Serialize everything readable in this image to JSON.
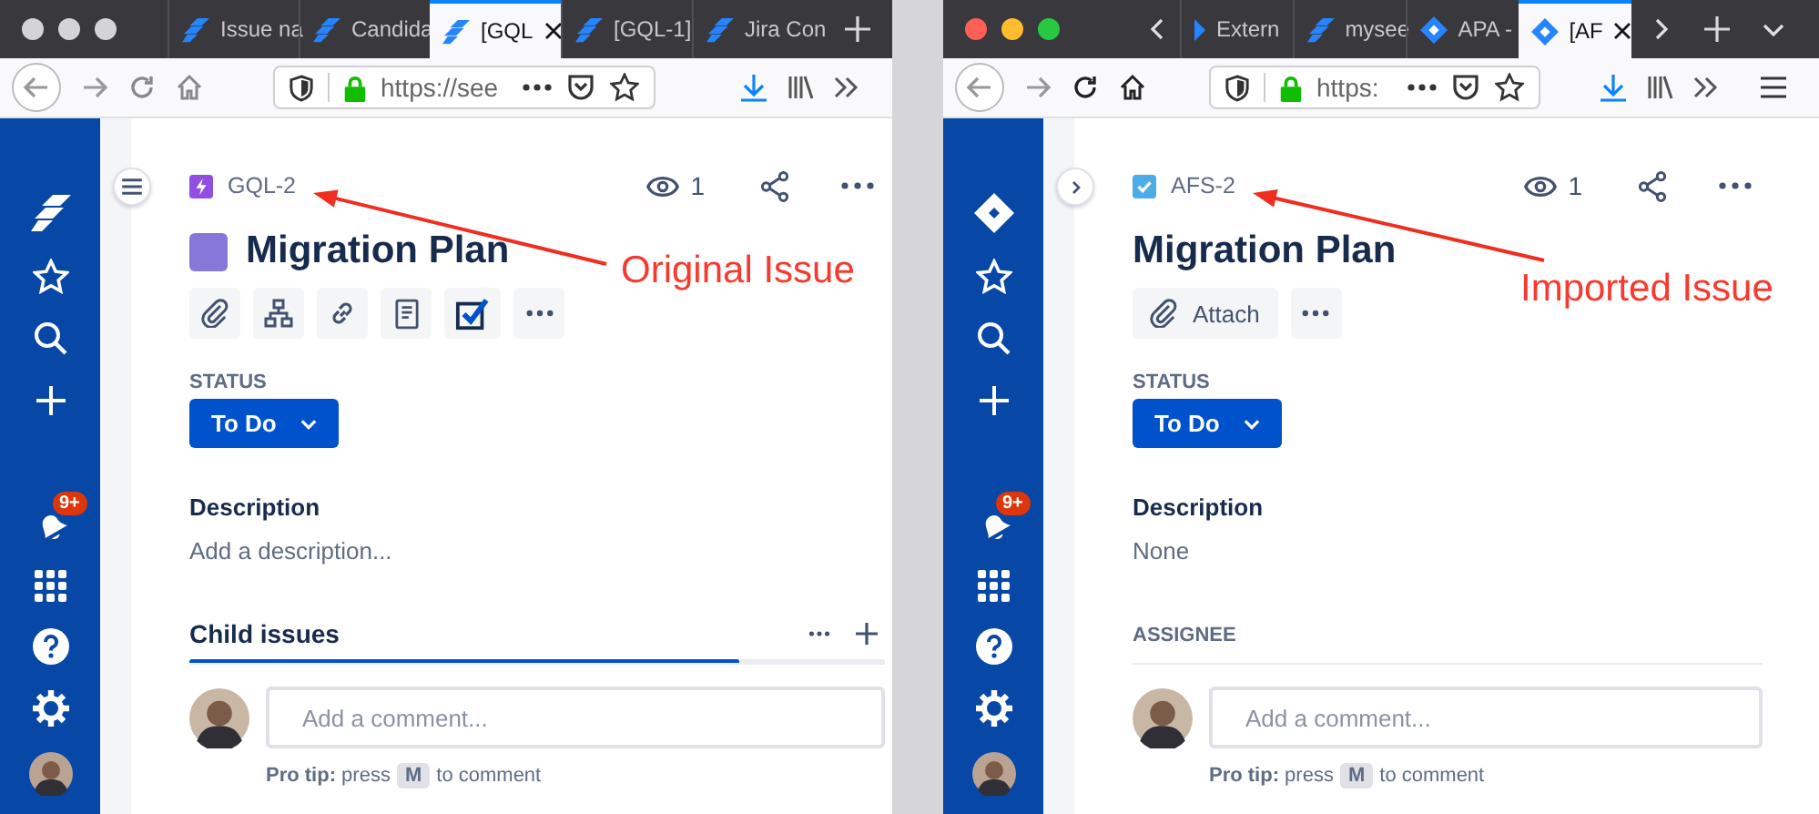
{
  "windows": [
    {
      "focused": false,
      "tab_scroll": false,
      "tabs": [
        {
          "kind": "software",
          "title": "Issue na",
          "selected": false
        },
        {
          "kind": "software",
          "title": "Candida",
          "selected": false
        },
        {
          "kind": "software",
          "title": "[GQL",
          "selected": true
        },
        {
          "kind": "software",
          "title": "[GQL-1]",
          "selected": false
        },
        {
          "kind": "software",
          "title": "Jira Con",
          "selected": false
        }
      ],
      "url": "https://see",
      "sidebar": {
        "kind": "software",
        "notifications": "9+"
      },
      "sidebar_toggle": {
        "kind": "menu"
      },
      "issue": {
        "kind": "epic",
        "key": "GQL-2",
        "watchers": "1",
        "title": "Migration Plan",
        "actions": [
          {
            "kind": "attach"
          },
          {
            "kind": "child"
          },
          {
            "kind": "link"
          },
          {
            "kind": "page"
          },
          {
            "kind": "checklist"
          },
          {
            "kind": "more"
          }
        ],
        "status_label": "STATUS",
        "status": "To Do",
        "description_heading": "Description",
        "description": "Add a description...",
        "section": {
          "kind": "child_issues",
          "title": "Child issues",
          "level": 0.79
        }
      },
      "comment": {
        "placeholder": "Add a comment...",
        "tip": "**Pro tip:** press",
        "key": "M",
        "tip_end": "to comment"
      },
      "annotation": "Original Issue"
    },
    {
      "focused": true,
      "tab_scroll": true,
      "tabs": [
        {
          "kind": "arrow",
          "title": "Extern",
          "selected": false
        },
        {
          "kind": "software",
          "title": "mysee",
          "selected": false
        },
        {
          "kind": "diamond",
          "title": "APA -",
          "selected": false
        },
        {
          "kind": "diamond",
          "title": "[AF",
          "selected": true
        }
      ],
      "url": "https:",
      "sidebar": {
        "kind": "diamond",
        "notifications": "9+"
      },
      "sidebar_toggle": {
        "kind": "expand"
      },
      "issue": {
        "kind": "task",
        "key": "AFS-2",
        "watchers": "1",
        "title": "Migration Plan",
        "actions": [
          {
            "kind": "attach",
            "label": "Attach"
          },
          {
            "kind": "more"
          }
        ],
        "status_label": "STATUS",
        "status": "To Do",
        "description_heading": "Description",
        "description": "None",
        "section": {
          "kind": "assignee",
          "title": "ASSIGNEE"
        }
      },
      "comment": {
        "placeholder": "Add a comment...",
        "tip": "**Pro tip:** press",
        "key": "M",
        "tip_end": "to comment"
      },
      "annotation": "Imported Issue"
    }
  ]
}
